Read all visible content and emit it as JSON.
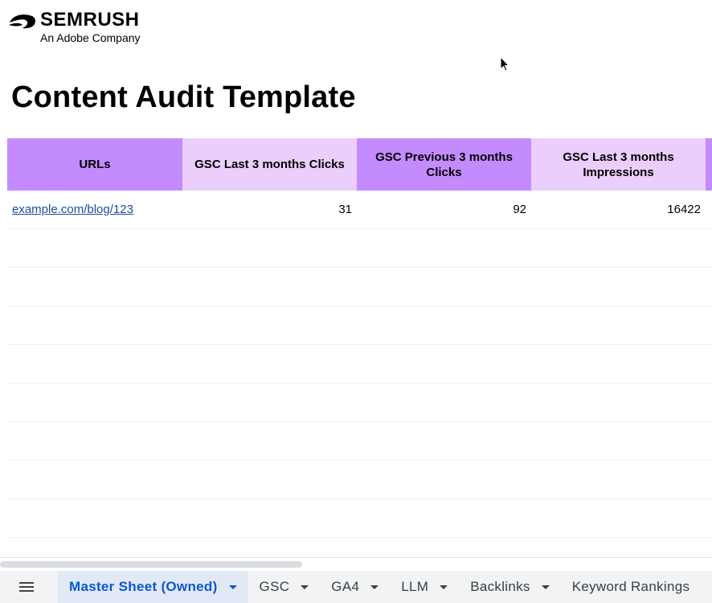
{
  "logo": {
    "brand": "SEMRUSH",
    "subtitle": "An Adobe Company"
  },
  "title": "Content Audit Template",
  "table": {
    "headers": [
      "URLs",
      "GSC Last 3 months Clicks",
      "GSC Previous 3 months Clicks",
      "GSC Last 3 months Impressions"
    ],
    "rows": [
      {
        "url": "example.com/blog/123",
        "last_clicks": "31",
        "prev_clicks": "92",
        "last_impressions": "16422"
      }
    ]
  },
  "tabs": [
    {
      "label": "Master Sheet (Owned)",
      "active": true
    },
    {
      "label": "GSC"
    },
    {
      "label": "GA4"
    },
    {
      "label": "LLM"
    },
    {
      "label": "Backlinks"
    },
    {
      "label": "Keyword Rankings"
    }
  ],
  "icons": {
    "logo": "semrush-flame-icon",
    "menu": "hamburger-menu-icon",
    "cursor": "mouse-pointer-icon",
    "tab_dropdown": "caret-down-icon"
  },
  "colors": {
    "header_dark": "#c48bff",
    "header_light": "#ebcefb",
    "link": "#1a4d9c",
    "active_tab_text": "#0b57d0",
    "active_tab_bg": "#e1e9f7"
  }
}
